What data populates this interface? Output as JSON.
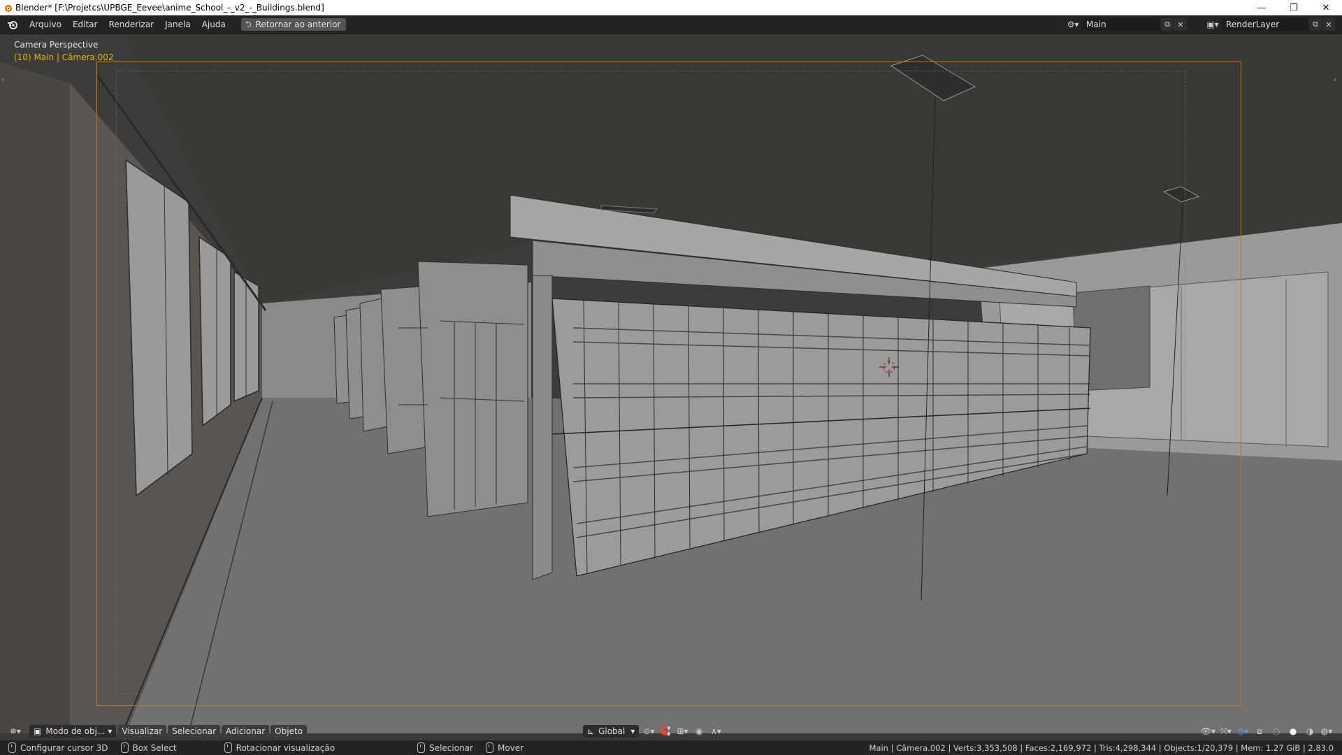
{
  "window": {
    "title": "Blender* [F:\\Projetcs\\UPBGE_Eevee\\anime_School_-_v2_-_Buildings.blend]",
    "minimize": "—",
    "restore": "❐",
    "close": "✕"
  },
  "topbar": {
    "menus": [
      "Arquivo",
      "Editar",
      "Renderizar",
      "Janela",
      "Ajuda"
    ],
    "back_button": "Retornar ao anterior",
    "scene_name": "Main",
    "view_layer": "RenderLayer"
  },
  "viewport": {
    "view_name": "Camera Perspective",
    "object_info": "(10) Main | Câmera.002",
    "accent_color": "#e0b400",
    "frame_color": "#c07a1e"
  },
  "header3d": {
    "mode": "Modo de obj...",
    "menus": [
      "Visualizar",
      "Selecionar",
      "Adicionar",
      "Objeto"
    ],
    "orientation": "Global"
  },
  "statusbar": {
    "items": [
      "Configurar cursor 3D",
      "Box Select",
      "Rotacionar visualização",
      "Selecionar",
      "Mover"
    ],
    "stats": "Main | Câmera.002 | Verts:3,353,508 | Faces:2,169,972 | Tris:4,298,344 | Objects:1/20,379 | Mem: 1.27 GiB | 2.83.0"
  }
}
